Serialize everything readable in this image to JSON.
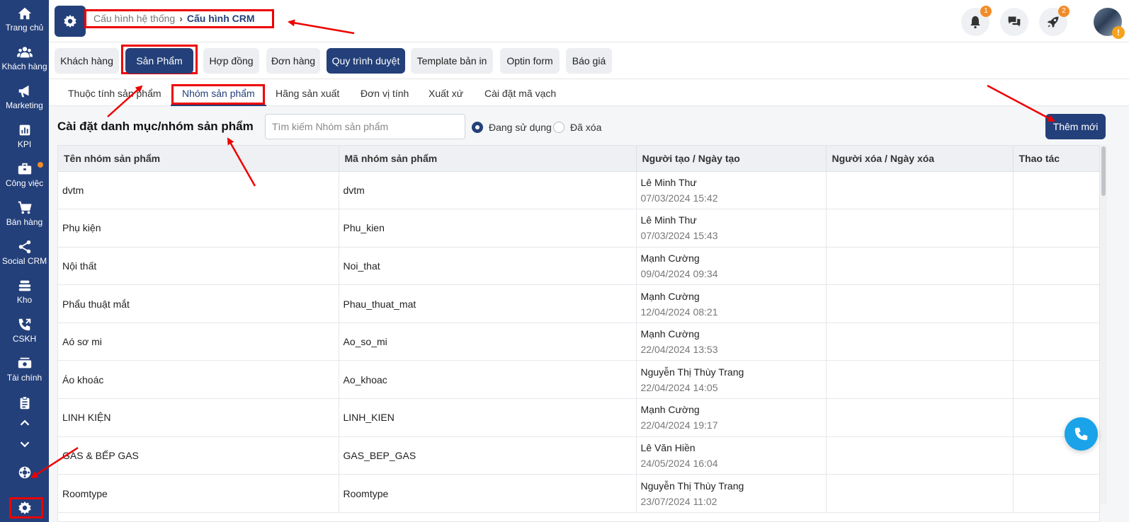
{
  "sidebar": {
    "items": [
      {
        "label": "Trang chủ",
        "icon": "home-icon"
      },
      {
        "label": "Khách hàng",
        "icon": "users-icon"
      },
      {
        "label": "Marketing",
        "icon": "megaphone-icon"
      },
      {
        "label": "KPI",
        "icon": "chart-icon"
      },
      {
        "label": "Công việc",
        "icon": "briefcase-icon"
      },
      {
        "label": "Bán hàng",
        "icon": "cart-icon"
      },
      {
        "label": "Social CRM",
        "icon": "share-icon"
      },
      {
        "label": "Kho",
        "icon": "warehouse-icon"
      },
      {
        "label": "CSKH",
        "icon": "phone-support-icon"
      },
      {
        "label": "Tài chính",
        "icon": "money-icon"
      }
    ]
  },
  "header": {
    "breadcrumb": {
      "parent": "Cấu hình hệ thống",
      "current": "Cấu hình CRM"
    },
    "notifications_badge": "1",
    "rocket_badge": "2",
    "avatar_warning": "!"
  },
  "top_tabs": [
    "Khách hàng",
    "Sản Phẩm",
    "Hợp đồng",
    "Đơn hàng",
    "Quy trình duyệt",
    "Template bản in",
    "Optin form",
    "Báo giá"
  ],
  "sub_tabs": [
    "Thuộc tính sản phẩm",
    "Nhóm sản phẩm",
    "Hãng sản xuất",
    "Đơn vị tính",
    "Xuất xứ",
    "Cài đặt mã vạch"
  ],
  "main": {
    "title": "Cài đặt danh mục/nhóm sản phẩm",
    "search_placeholder": "Tìm kiếm Nhóm sản phẩm",
    "radio_active": "Đang sử dụng",
    "radio_deleted": "Đã xóa",
    "add_button": "Thêm mới"
  },
  "table": {
    "columns": [
      "Tên nhóm sản phẩm",
      "Mã nhóm sản phẩm",
      "Người tạo / Ngày tạo",
      "Người xóa / Ngày xóa",
      "Thao tác"
    ],
    "rows": [
      {
        "name": "dvtm",
        "code": "dvtm",
        "creator": "Lê Minh Thư",
        "created": "07/03/2024 15:42"
      },
      {
        "name": "Phụ kiện",
        "code": "Phu_kien",
        "creator": "Lê Minh Thư",
        "created": "07/03/2024 15:43"
      },
      {
        "name": "Nội thất",
        "code": "Noi_that",
        "creator": "Mạnh Cường",
        "created": "09/04/2024 09:34"
      },
      {
        "name": "Phẩu thuật mắt",
        "code": "Phau_thuat_mat",
        "creator": "Mạnh Cường",
        "created": "12/04/2024 08:21"
      },
      {
        "name": "Aó sơ mi",
        "code": "Ao_so_mi",
        "creator": "Mạnh Cường",
        "created": "22/04/2024 13:53"
      },
      {
        "name": "Áo khoác",
        "code": "Ao_khoac",
        "creator": "Nguyễn Thị Thùy Trang",
        "created": "22/04/2024 14:05"
      },
      {
        "name": "LINH KIỆN",
        "code": "LINH_KIEN",
        "creator": "Mạnh Cường",
        "created": "22/04/2024 19:17"
      },
      {
        "name": "GAS & BẾP GAS",
        "code": "GAS_BEP_GAS",
        "creator": "Lê Văn Hiền",
        "created": "24/05/2024 16:04"
      },
      {
        "name": "Roomtype",
        "code": "Roomtype",
        "creator": "Nguyễn Thị Thùy Trang",
        "created": "23/07/2024 11:02"
      }
    ]
  },
  "colors": {
    "primary": "#24407a",
    "accent": "#f28c28",
    "annotation": "#e00000",
    "call": "#1aa3e8"
  }
}
